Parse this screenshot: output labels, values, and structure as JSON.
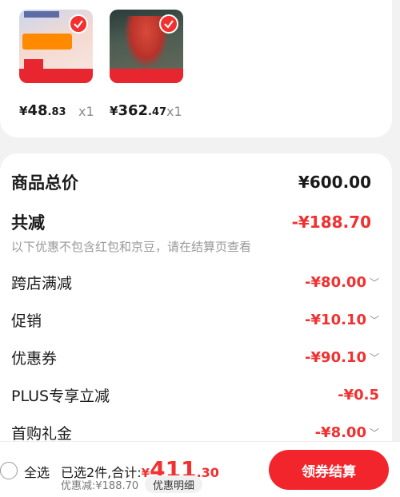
{
  "products": [
    {
      "currency": "¥",
      "int": "48",
      "dec": ".83",
      "qty": "x1",
      "image": "promo-product-image"
    },
    {
      "currency": "¥",
      "int": "362",
      "dec": ".47",
      "qty": "x1",
      "image": "red-jacket-image"
    }
  ],
  "summary": {
    "total_label": "商品总价",
    "total_value": "¥600.00",
    "reduce_label": "共减",
    "reduce_value": "-¥188.70",
    "note": "以下优惠不包含红包和京豆，请在结算页查看",
    "items": [
      {
        "label": "跨店满减",
        "value": "-¥80.00",
        "chevron": true
      },
      {
        "label": "促销",
        "value": "-¥10.10",
        "chevron": true
      },
      {
        "label": "优惠券",
        "value": "-¥90.10",
        "chevron": true
      },
      {
        "label": "PLUS专享立减",
        "value": "-¥0.5",
        "chevron": false
      },
      {
        "label": "首购礼金",
        "value": "-¥8.00",
        "chevron": true
      }
    ]
  },
  "bottom": {
    "select_all": "全选",
    "selected_text": "已选2件,合计:",
    "amount_cur": "¥",
    "amount_int": "411",
    "amount_dec": ".30",
    "discount_text": "优惠减:¥188.70",
    "detail_btn": "优惠明细",
    "checkout_btn": "领券结算"
  },
  "colors": {
    "accent": "#f23030",
    "checkout": "#f2242c"
  }
}
